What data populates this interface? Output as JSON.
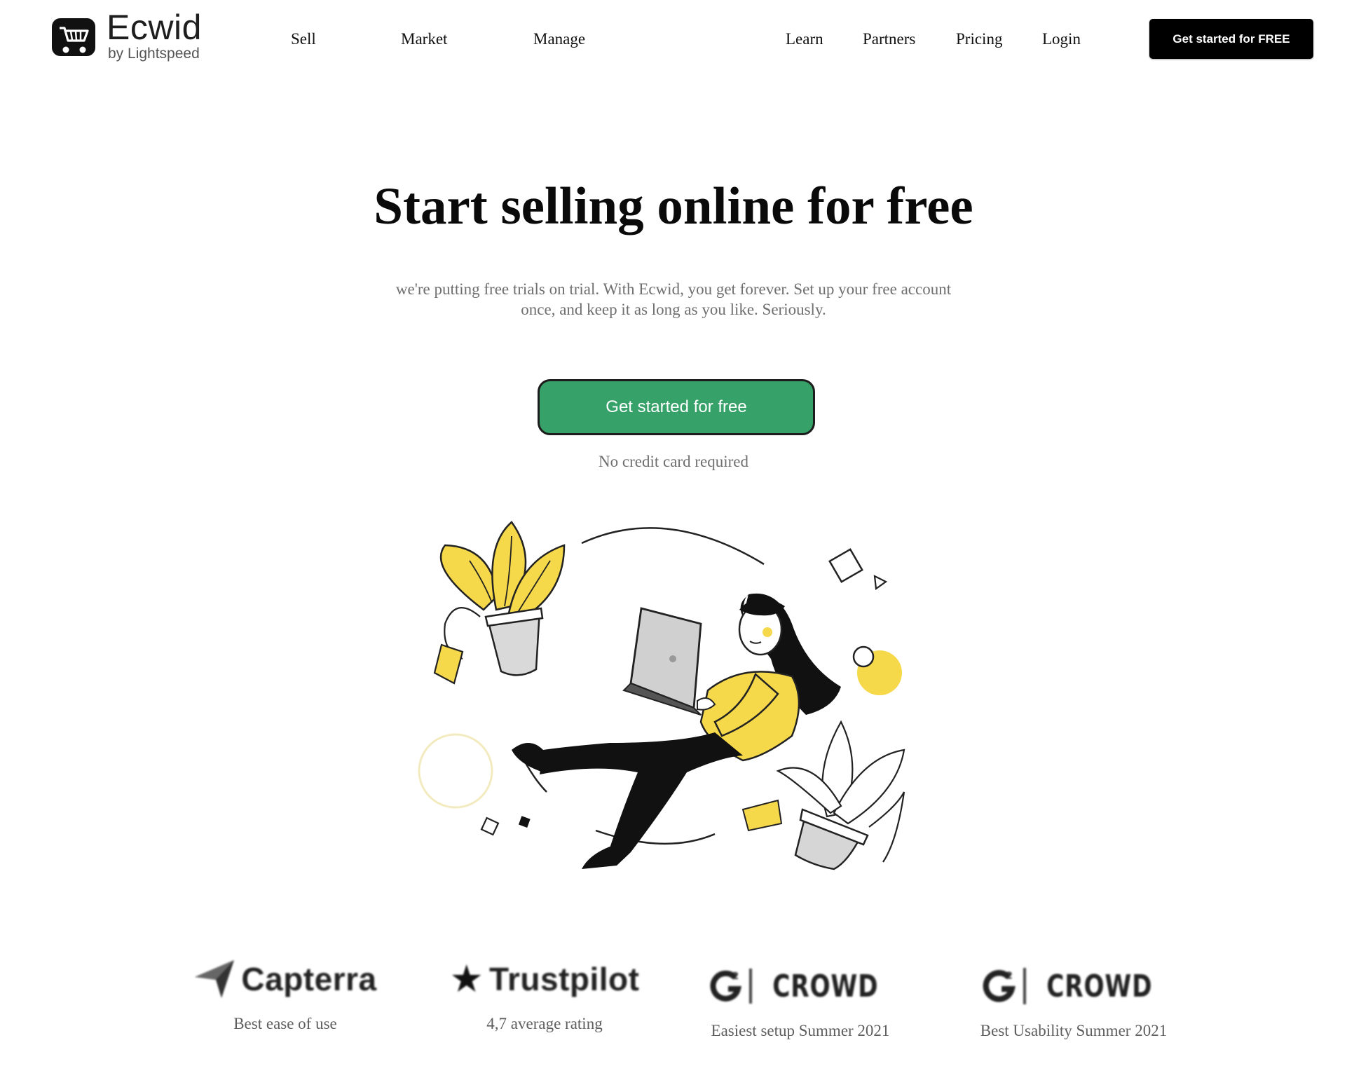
{
  "header": {
    "logo": {
      "name": "Ecwid",
      "tagline": "by Lightspeed"
    },
    "nav_left": [
      "Sell",
      "Market",
      "Manage"
    ],
    "nav_right": [
      "Learn",
      "Partners",
      "Pricing",
      "Login"
    ],
    "cta_label": "Get started for FREE"
  },
  "hero": {
    "title": "Start selling online for free",
    "subtitle": "we're putting free trials on trial. With Ecwid, you get forever. Set up your free account once, and keep it as long as you like. Seriously.",
    "cta_label": "Get started for free",
    "note": "No credit card required"
  },
  "awards": [
    {
      "brand": "Capterra",
      "caption": "Best ease of use",
      "icon": "capterra-arrow-icon"
    },
    {
      "brand": "Trustpilot",
      "caption": "4,7 average rating",
      "icon": "trustpilot-star-icon"
    },
    {
      "brand": "CROWD",
      "caption": "Easiest setup Summer 2021",
      "icon": "g2-logo-icon"
    },
    {
      "brand": "CROWD",
      "caption": "Best Usability Summer 2021",
      "icon": "g2-logo-icon"
    }
  ],
  "colors": {
    "accent_green": "#36a168",
    "illustration_yellow": "#f5d94a",
    "text_muted": "#6f6f6f",
    "cta_black": "#000000"
  }
}
